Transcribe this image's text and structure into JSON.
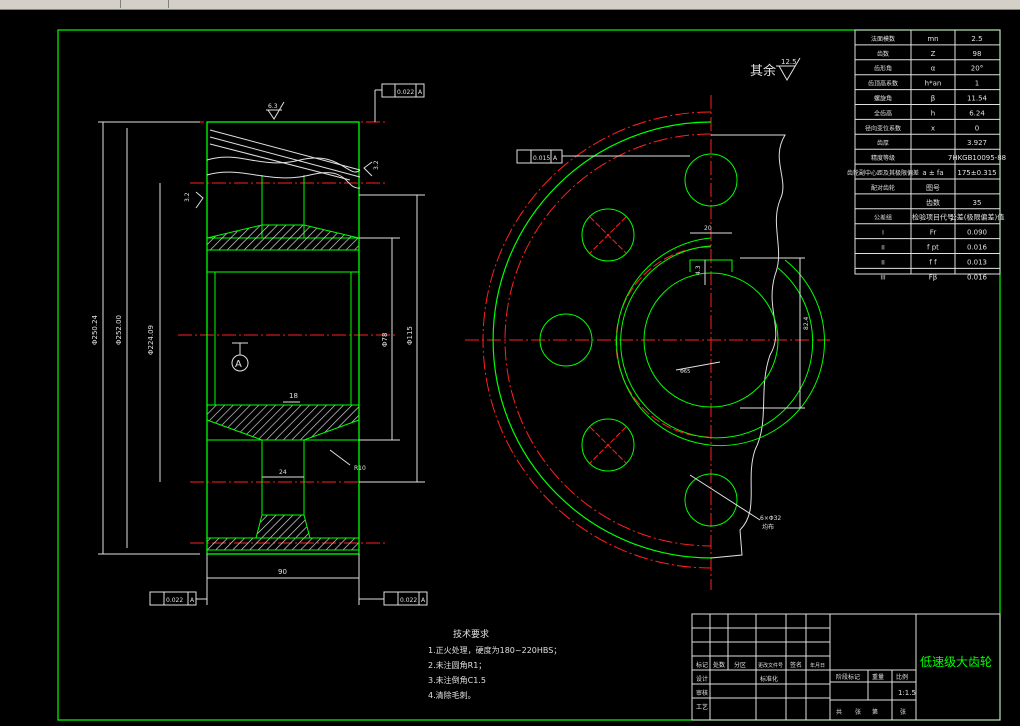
{
  "surface_note": {
    "mark": "其余",
    "roughness": "12.5"
  },
  "params": [
    [
      "法面模数",
      "mn",
      "2.5"
    ],
    [
      "齿数",
      "Z",
      "98"
    ],
    [
      "齿形角",
      "α",
      "20°"
    ],
    [
      "齿顶高系数",
      "h*an",
      "1"
    ],
    [
      "螺旋角",
      "β",
      "11.54"
    ],
    [
      "全齿高",
      "h",
      "6.24"
    ],
    [
      "径向变位系数",
      "x",
      "0"
    ],
    [
      "齿厚",
      "",
      "3.927"
    ],
    [
      "精度等级",
      "",
      "7HKGB10095-88"
    ],
    [
      "齿轮副中心距及其极限偏差",
      "a ± fa",
      "175±0.315"
    ],
    [
      "配对齿轮",
      "图号",
      ""
    ],
    [
      "",
      "齿数",
      "35"
    ]
  ],
  "tolerance_header": [
    "公差组",
    "检验项目代号",
    "公差(极限偏差)值"
  ],
  "tolerances": [
    [
      "I",
      "Fr",
      "0.090"
    ],
    [
      "II",
      "f pt",
      "0.016"
    ],
    [
      "II",
      "f f",
      "0.013"
    ],
    [
      "III",
      "Fβ",
      "0.016"
    ]
  ],
  "dims": {
    "d_outer": "Φ250.24",
    "d_root": "Φ252.00",
    "d_bolt": "Φ224.09",
    "d_hub": "Φ115",
    "d_bore": "Φ78",
    "width": "90",
    "web": "18",
    "hub_len": "24",
    "key_h": "82.4",
    "key_w": "20",
    "fillet": "R10",
    "keyway": "4.3",
    "bore_dia": "Φ65",
    "holes": "6×Φ32",
    "holes_note": "均布"
  },
  "gdt": {
    "top": [
      "0.022",
      "A"
    ],
    "runout": [
      "0.015",
      "A"
    ],
    "bottom_left": [
      "0.022",
      "A"
    ],
    "bottom_right": [
      "0.022",
      "A"
    ],
    "datum": "A",
    "rough_a": "6.3",
    "rough_b": "3.2",
    "rough_c": "3.2"
  },
  "tech": {
    "title": "技术要求",
    "items": [
      "1.正火处理，硬度为180~220HBS；",
      "2.未注圆角R1；",
      "3.未注倒角C1.5",
      "4.清除毛刺。"
    ]
  },
  "title_block": {
    "name": "低速级大齿轮",
    "scale": "1:1.5",
    "left_labels": [
      "标记",
      "处数",
      "分区",
      "更改文件号",
      "签名",
      "年月日"
    ],
    "rows": [
      "设计",
      "审核",
      "工艺"
    ],
    "mid_labels": [
      "标准化",
      "阶段标记",
      "重量",
      "比例"
    ],
    "bottom": [
      "共",
      "张",
      "第",
      "张"
    ]
  }
}
